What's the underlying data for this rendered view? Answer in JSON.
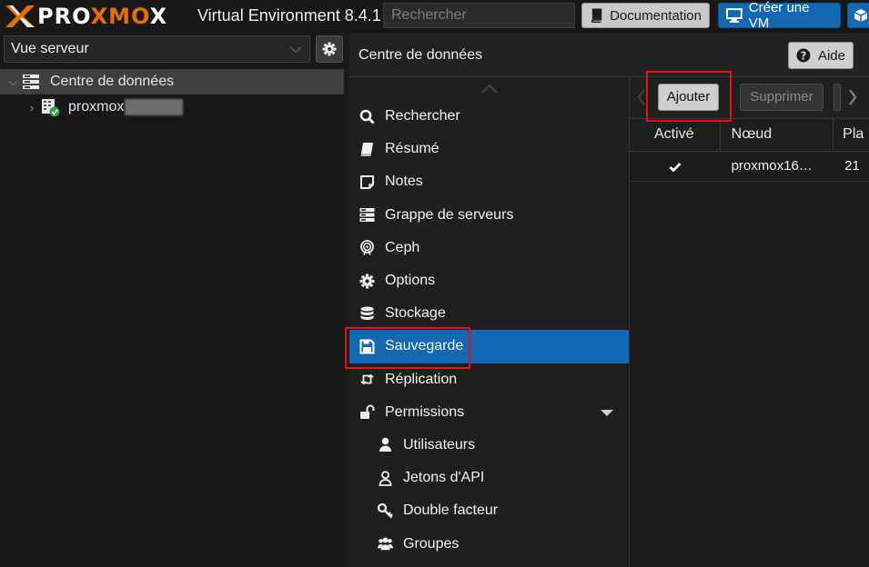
{
  "brand": {
    "logo_text_1": "PRO",
    "logo_text_2": "XMO",
    "logo_text_3": "X",
    "logo_accent": "#e57000"
  },
  "header": {
    "title": "Virtual Environment 8.4.1",
    "search_placeholder": "Rechercher",
    "documentation_label": "Documentation",
    "create_vm_label": "Créer une VM",
    "accent_color": "#1368b3"
  },
  "left_panel": {
    "view_select_value": "Vue serveur",
    "tree": [
      {
        "label": "Centre de données",
        "icon": "datacenter-icon",
        "selected": true
      },
      {
        "label": "proxmox",
        "icon": "node-online-icon",
        "selected": false
      }
    ]
  },
  "panel": {
    "title": "Centre de données",
    "help_label": "Aide"
  },
  "nav": {
    "items": [
      {
        "label": "Rechercher",
        "icon": "search-icon"
      },
      {
        "label": "Résumé",
        "icon": "book-icon"
      },
      {
        "label": "Notes",
        "icon": "note-icon"
      },
      {
        "label": "Grappe de serveurs",
        "icon": "server-icon"
      },
      {
        "label": "Ceph",
        "icon": "ceph-icon"
      },
      {
        "label": "Options",
        "icon": "gear-icon"
      },
      {
        "label": "Stockage",
        "icon": "database-icon"
      },
      {
        "label": "Sauvegarde",
        "icon": "floppy-icon",
        "active": true
      },
      {
        "label": "Réplication",
        "icon": "retweet-icon"
      },
      {
        "label": "Permissions",
        "icon": "unlock-icon",
        "expanded": true
      },
      {
        "label": "Utilisateurs",
        "icon": "user-icon",
        "sub": true
      },
      {
        "label": "Jetons d'API",
        "icon": "user-outline-icon",
        "sub": true
      },
      {
        "label": "Double facteur",
        "icon": "key-icon",
        "sub": true
      },
      {
        "label": "Groupes",
        "icon": "users-icon",
        "sub": true
      }
    ]
  },
  "toolbar": {
    "add_label": "Ajouter",
    "remove_label": "Supprimer"
  },
  "grid": {
    "columns": [
      "Activé",
      "Nœud",
      "Pla"
    ],
    "rows": [
      {
        "enabled": true,
        "node": "proxmox16…",
        "plan": "21"
      }
    ]
  },
  "highlight_color": "#e0131b"
}
